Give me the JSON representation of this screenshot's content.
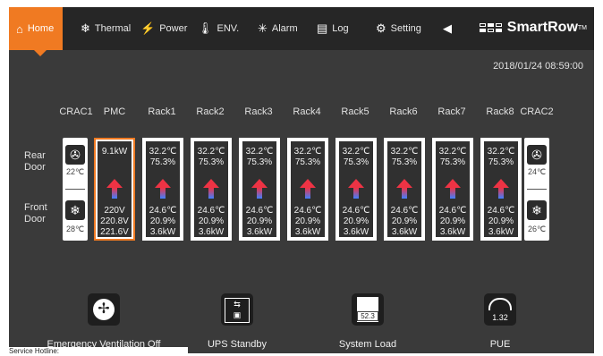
{
  "nav": {
    "tabs": [
      {
        "label": "Home",
        "icon": "home-icon"
      },
      {
        "label": "Thermal",
        "icon": "snowflake-icon"
      },
      {
        "label": "Power",
        "icon": "plug-icon"
      },
      {
        "label": "ENV.",
        "icon": "thermometer-icon"
      },
      {
        "label": "Alarm",
        "icon": "alarm-light-icon"
      },
      {
        "label": "Log",
        "icon": "log-icon"
      },
      {
        "label": "Setting",
        "icon": "gear-icon"
      },
      {
        "label": "",
        "icon": "speaker-icon"
      }
    ],
    "brand": "SmartRow",
    "brand_tm": "TM"
  },
  "timestamp": "2018/01/24 08:59:00",
  "doors": {
    "rear": "Rear Door",
    "front": "Front Door"
  },
  "columns": [
    "CRAC1",
    "PMC",
    "Rack1",
    "Rack2",
    "Rack3",
    "Rack4",
    "Rack5",
    "Rack6",
    "Rack7",
    "Rack8",
    "CRAC2"
  ],
  "crac1": {
    "rear_temp": "22℃",
    "front_temp": "28℃"
  },
  "crac2": {
    "rear_temp": "24℃",
    "front_temp": "26℃"
  },
  "pmc": {
    "top": "9.1kW",
    "bottom": [
      "220V",
      "220.8V",
      "221.6V"
    ]
  },
  "racks": [
    {
      "rear": [
        "32.2℃",
        "75.3%"
      ],
      "front": [
        "24.6℃",
        "20.9%",
        "3.6kW"
      ]
    },
    {
      "rear": [
        "32.2℃",
        "75.3%"
      ],
      "front": [
        "24.6℃",
        "20.9%",
        "3.6kW"
      ]
    },
    {
      "rear": [
        "32.2℃",
        "75.3%"
      ],
      "front": [
        "24.6℃",
        "20.9%",
        "3.6kW"
      ]
    },
    {
      "rear": [
        "32.2℃",
        "75.3%"
      ],
      "front": [
        "24.6℃",
        "20.9%",
        "3.6kW"
      ]
    },
    {
      "rear": [
        "32.2℃",
        "75.3%"
      ],
      "front": [
        "24.6℃",
        "20.9%",
        "3.6kW"
      ]
    },
    {
      "rear": [
        "32.2℃",
        "75.3%"
      ],
      "front": [
        "24.6℃",
        "20.9%",
        "3.6kW"
      ]
    },
    {
      "rear": [
        "32.2℃",
        "75.3%"
      ],
      "front": [
        "24.6℃",
        "20.9%",
        "3.6kW"
      ]
    },
    {
      "rear": [
        "32.2℃",
        "75.3%"
      ],
      "front": [
        "24.6℃",
        "20.9%",
        "3.6kW"
      ]
    }
  ],
  "bottom": [
    {
      "label": "Emergency Ventilation Off",
      "icon": "fan-icon"
    },
    {
      "label": "UPS Standby",
      "icon": "ups-icon"
    },
    {
      "label": "System Load",
      "icon": "gauge-box-icon",
      "value": "52.3"
    },
    {
      "label": "PUE",
      "icon": "speedometer-icon",
      "value": "1.32"
    }
  ],
  "footer": {
    "hotline": "Service Hotline:"
  },
  "colors": {
    "accent": "#f07a22",
    "bg": "#3a3a3a",
    "bar": "#262626"
  }
}
